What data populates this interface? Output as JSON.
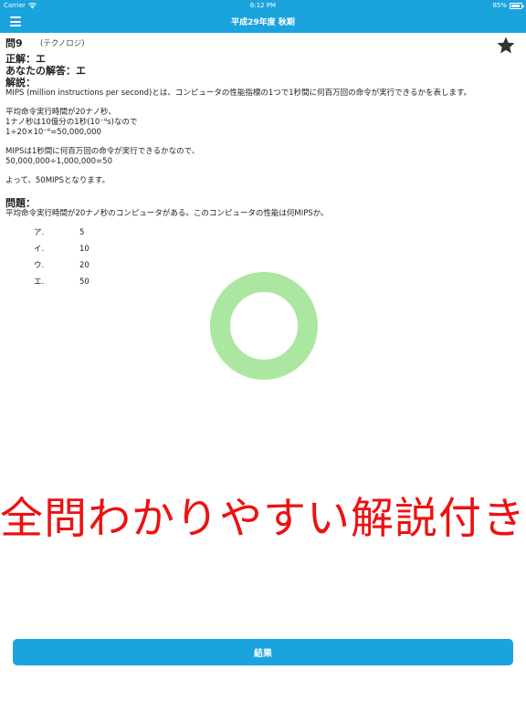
{
  "status": {
    "carrier": "Carrier",
    "time": "6:12 PM",
    "battery": "85%",
    "battery_level": 0.85
  },
  "nav": {
    "title": "平成29年度 秋期"
  },
  "question": {
    "number": "問9",
    "category": "(テクノロジ)",
    "correct": "正解：エ",
    "your_answer": "あなたの解答：エ",
    "explanation_title": "解説：",
    "explanation": [
      "MIPS (million instructions per second)とは、コンピュータの性能指標の1つで1秒間に何百万回の命令が実行できるかを表します。",
      "平均命令実行時間が20ナノ秒、\n1ナノ秒は10億分の1秒(10⁻⁹s)なので\n1÷20×10⁻⁹=50,000,000",
      "MIPSは1秒間に何百万回の命令が実行できるかなので、\n50,000,000÷1,000,000=50",
      "よって、50MIPSとなります。"
    ],
    "problem_title": "問題：",
    "problem_text": "平均命令実行時間が20ナノ秒のコンピュータがある。このコンピュータの性能は何MIPSか。",
    "choices": [
      {
        "label": "ア.",
        "value": "5"
      },
      {
        "label": "イ.",
        "value": "10"
      },
      {
        "label": "ウ.",
        "value": "20"
      },
      {
        "label": "エ.",
        "value": "50"
      }
    ]
  },
  "promo_text": "全問わかりやすい解説付き",
  "result_button": "結果",
  "colors": {
    "accent": "#1aa3dd",
    "ring": "#abe7a0",
    "promo": "#ee1111"
  }
}
